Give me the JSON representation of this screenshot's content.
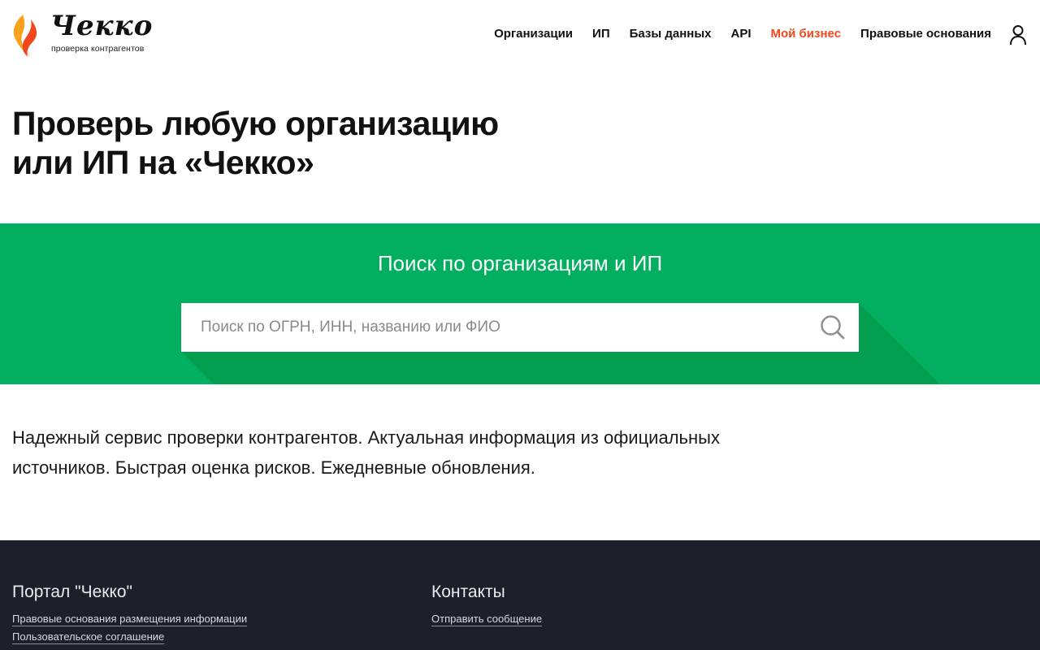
{
  "brand": {
    "name": "Чекко",
    "tagline": "проверка контрагентов",
    "colors": {
      "flame_orange": "#f0481c",
      "flame_yellow": "#f9a21b",
      "accent_green": "#02ae5f",
      "footer_bg": "#1c202b"
    }
  },
  "nav": {
    "items": [
      {
        "label": "Организации"
      },
      {
        "label": "ИП"
      },
      {
        "label": "Базы данных"
      },
      {
        "label": "API"
      },
      {
        "label": "Мой бизнес",
        "active": true
      },
      {
        "label": "Правовые основания"
      }
    ],
    "user_icon": "user-icon"
  },
  "hero": {
    "line1": "Проверь любую организацию",
    "line2": "или ИП на «Чекко»"
  },
  "search": {
    "title": "Поиск по организациям и ИП",
    "placeholder": "Поиск по ОГРН, ИНН, названию или ФИО",
    "value": "",
    "icon": "search-icon"
  },
  "tagline": {
    "line1": "Надежный сервис проверки контрагентов. Актуальная информация из официальных",
    "line2": "источников. Быстрая оценка рисков. Ежедневные обновления."
  },
  "footer": {
    "portal": {
      "title": "Портал \"Чекко\"",
      "links": [
        "Правовые основания размещения информации",
        "Пользовательское соглашение"
      ]
    },
    "contacts": {
      "title": "Контакты",
      "links": [
        "Отправить сообщение"
      ]
    }
  }
}
